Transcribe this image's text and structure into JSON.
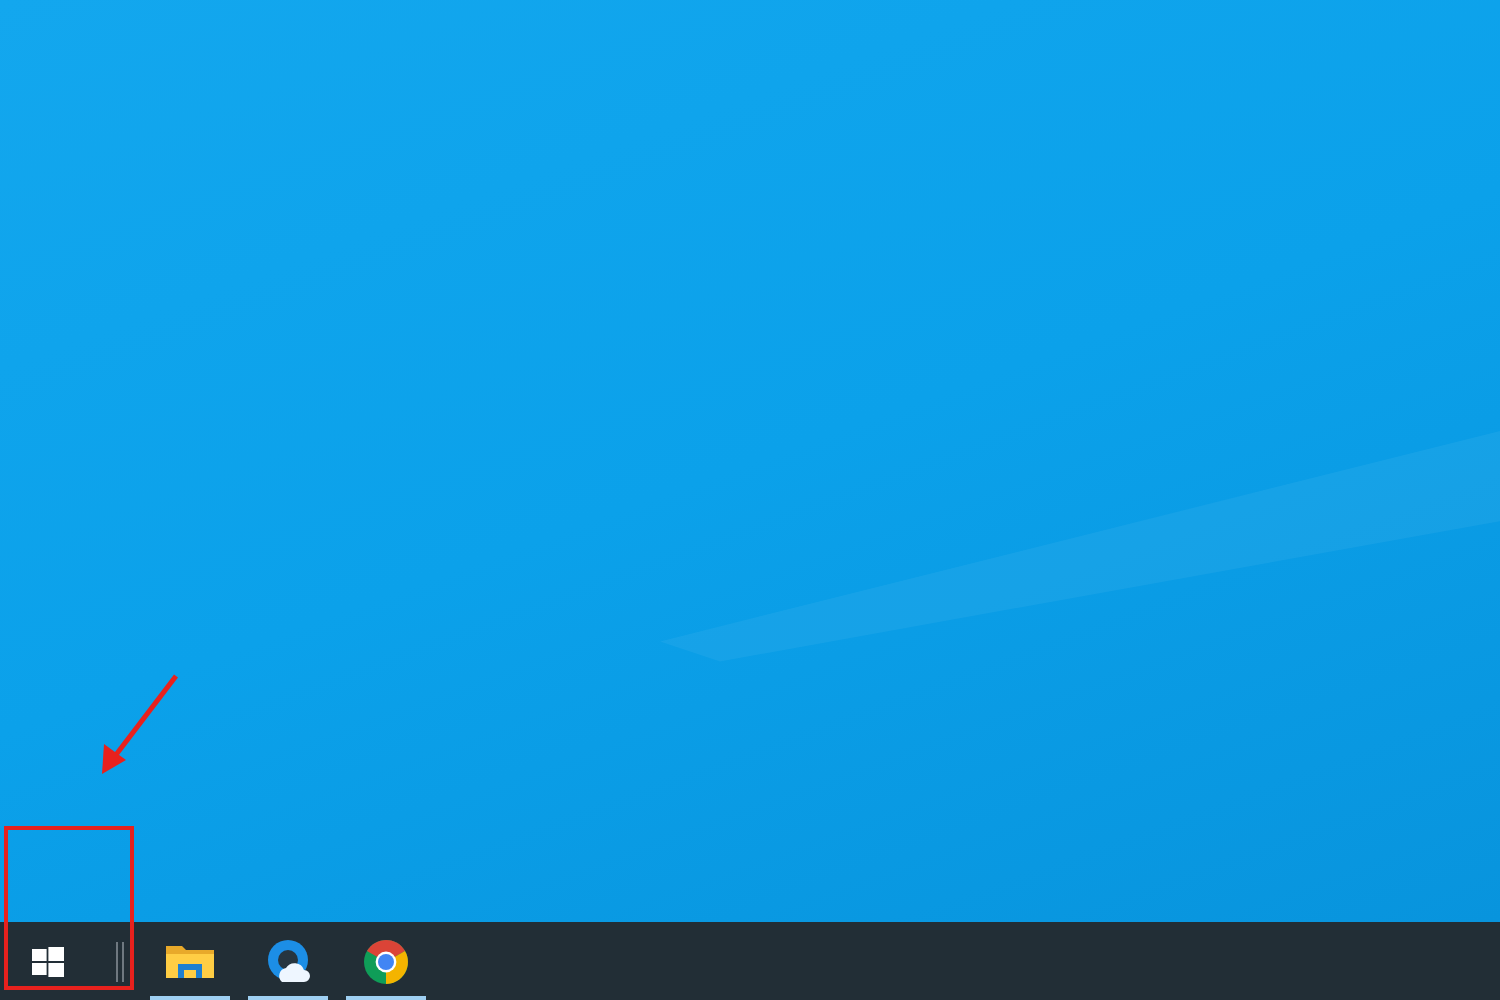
{
  "taskbar": {
    "apps": [
      {
        "kind": "folder",
        "running": true
      },
      {
        "kind": "edge",
        "running": true
      },
      {
        "kind": "chrome",
        "running": true
      }
    ]
  }
}
